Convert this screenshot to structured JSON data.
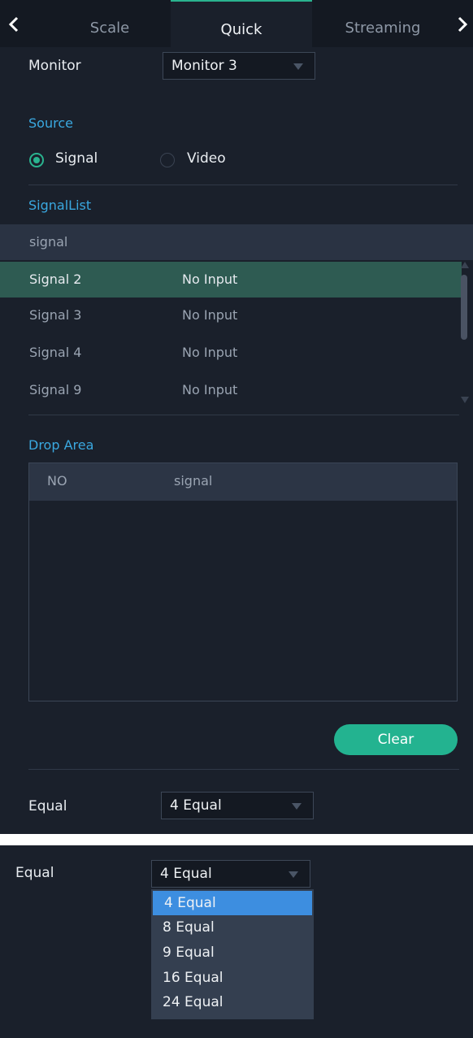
{
  "tabs": [
    "Scale",
    "Quick",
    "Streaming"
  ],
  "monitor": {
    "label": "Monitor",
    "value": "Monitor 3"
  },
  "source": {
    "heading": "Source",
    "options": [
      "Signal",
      "Video"
    ],
    "selected": "Signal"
  },
  "signal_list": {
    "heading": "SignalList",
    "column": "signal",
    "rows": [
      {
        "name": "Signal 2",
        "status": "No Input"
      },
      {
        "name": "Signal 3",
        "status": "No Input"
      },
      {
        "name": "Signal 4",
        "status": "No Input"
      },
      {
        "name": "Signal 9",
        "status": "No Input"
      }
    ],
    "selected_index": 0
  },
  "drop_area": {
    "heading": "Drop Area",
    "columns": [
      "NO",
      "signal"
    ]
  },
  "clear_label": "Clear",
  "equal": {
    "label": "Equal",
    "value": "4 Equal"
  },
  "equal_dropdown": {
    "label": "Equal",
    "value": "4 Equal",
    "options": [
      "4 Equal",
      "8 Equal",
      "9 Equal",
      "16 Equal",
      "24 Equal"
    ],
    "highlighted_index": 0
  },
  "colors": {
    "accent": "#2ab38f",
    "section": "#3aa8e0",
    "selected_row": "#2e5b52",
    "highlight": "#3d8ee0"
  }
}
